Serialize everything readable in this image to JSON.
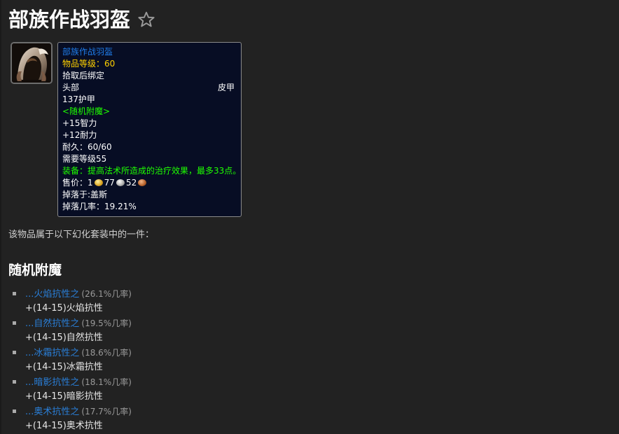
{
  "header": {
    "title": "部族作战羽盔",
    "favorite_icon": "star-outline-icon"
  },
  "item_icon": {
    "icon": "hooded-helm-icon"
  },
  "tooltip": {
    "name": "部族作战羽盔",
    "item_level": "物品等级：60",
    "bind": "拾取后绑定",
    "slot": "头部",
    "armor_type": "皮甲",
    "armor": "137护甲",
    "random_enchant": "<随机附魔>",
    "stat1": "+15智力",
    "stat2": "+12耐力",
    "durability": "耐久：60/60",
    "required_level": "需要等级55",
    "equip_effect": "装备：提高法术所造成的治疗效果，最多33点。",
    "sell_label": "售价：",
    "sell_gold": "1",
    "sell_silver": "77",
    "sell_copper": "52",
    "drop_from": "掉落于:盖斯",
    "drop_rate": "掉落几率：19.21%",
    "colors": {
      "name": "#1f7ce8",
      "item_level": "#ffd100",
      "green": "#1eff00",
      "background": "#070d24"
    }
  },
  "set_note": "该物品属于以下幻化套装中的一件：",
  "random_enchant_section": {
    "heading": "随机附魔",
    "items": [
      {
        "name": "...火焰抗性之",
        "chance": "(26.1%几率)",
        "stat": "+(14-15)火焰抗性"
      },
      {
        "name": "...自然抗性之",
        "chance": "(19.5%几率)",
        "stat": "+(14-15)自然抗性"
      },
      {
        "name": "...冰霜抗性之",
        "chance": "(18.6%几率)",
        "stat": "+(14-15)冰霜抗性"
      },
      {
        "name": "...暗影抗性之",
        "chance": "(18.1%几率)",
        "stat": "+(14-15)暗影抗性"
      },
      {
        "name": "...奥术抗性之",
        "chance": "(17.7%几率)",
        "stat": "+(14-15)奥术抗性"
      }
    ]
  }
}
